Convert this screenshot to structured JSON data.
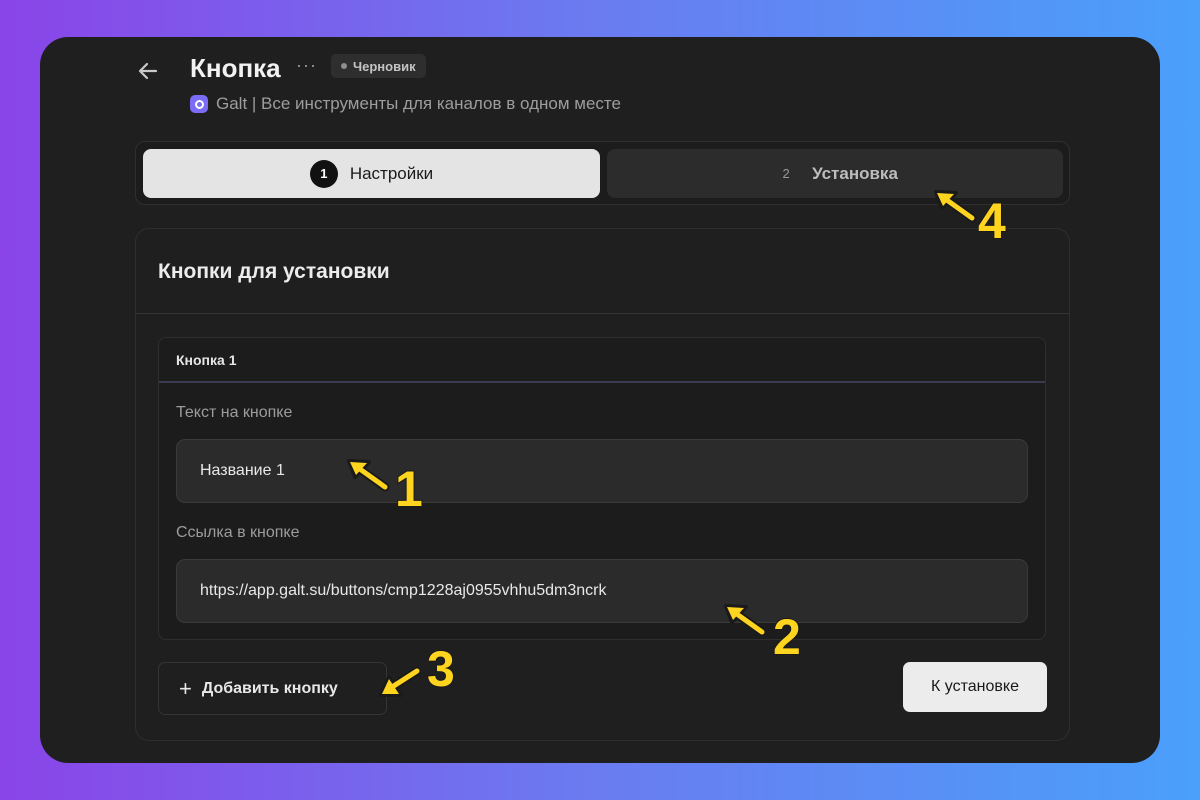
{
  "header": {
    "title": "Кнопка",
    "more": "···",
    "status": "Черновик",
    "channel_name": "Galt | Все инструменты для каналов в одном месте"
  },
  "stepper": {
    "steps": [
      {
        "num": "1",
        "label": "Настройки",
        "active": true
      },
      {
        "num": "2",
        "label": "Установка",
        "active": false
      }
    ]
  },
  "card": {
    "title": "Кнопки для установки",
    "button_block": {
      "header": "Кнопка 1",
      "text_label": "Текст на кнопке",
      "text_value": "Название 1",
      "link_label": "Ссылка в кнопке",
      "link_value": "https://app.galt.su/buttons/cmp1228aj0955vhhu5dm3ncrk"
    },
    "add_button_label": "Добавить кнопку",
    "next_button_label": "К установке"
  },
  "annotations": {
    "labels": [
      "1",
      "2",
      "3",
      "4"
    ],
    "color": "#ffd41f"
  },
  "colors": {
    "background_left": "#8a44e8",
    "background_right": "#4aa0fb",
    "window": "#1f1f1f",
    "active_step": "#e4e4e4",
    "brand_logo": "#7b6cf6"
  }
}
